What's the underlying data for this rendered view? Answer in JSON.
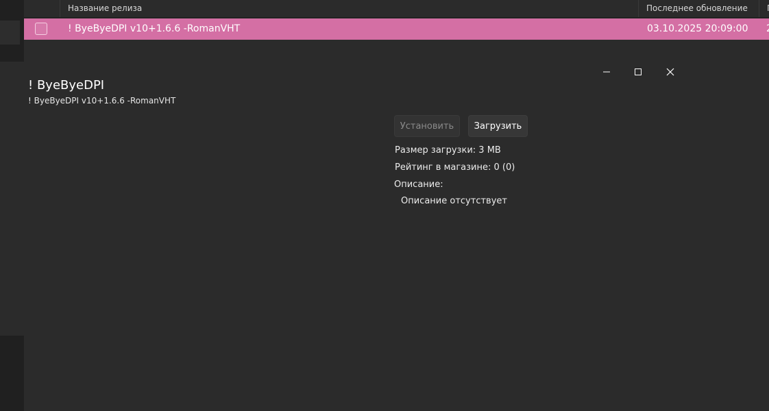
{
  "table": {
    "headers": {
      "name": "Название релиза",
      "updated": "Последнее обновление",
      "extra": "П"
    },
    "rows": [
      {
        "name": "! ByeByeDPI v10+1.6.6 -RomanVHT",
        "updated": "03.10.2025 20:09:00",
        "extra": "2",
        "selected": true,
        "highlight_color": "#d46fa4"
      }
    ]
  },
  "dialog": {
    "title": "! ByeByeDPI",
    "subtitle": "! ByeByeDPI v10+1.6.6 -RomanVHT",
    "install_label": "Установить",
    "download_label": "Загрузить",
    "size_text": "Размер загрузки: 3 MB",
    "rating_text": "Рейтинг в магазине: 0 (0)",
    "description_label": "Описание:",
    "description_text": "Описание отсутствует",
    "window_controls": [
      "minimize-icon",
      "maximize-icon",
      "close-icon"
    ]
  },
  "colors": {
    "background": "#2b2b2b",
    "accent": "#d46fa4",
    "disabled_text": "#8a8a8a"
  }
}
